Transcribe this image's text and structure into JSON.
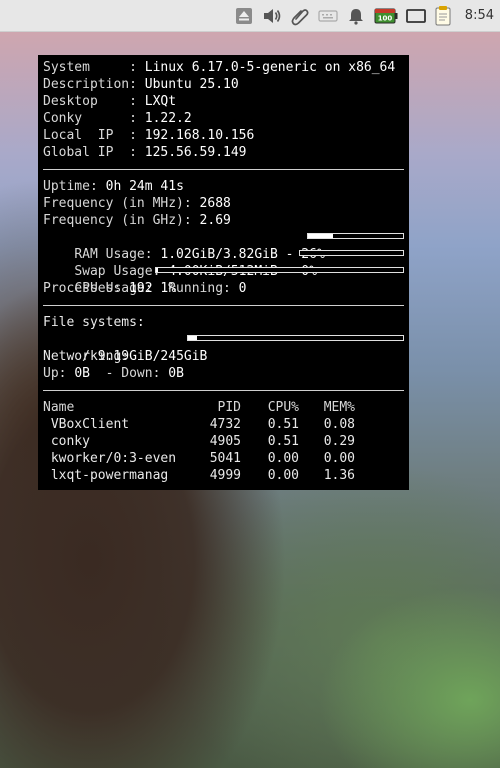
{
  "panel": {
    "clock": "8:54",
    "battery_badge": "100",
    "icons": [
      "eject-icon",
      "volume-icon",
      "paperclip-icon",
      "keyboard-icon",
      "notification-bell-icon",
      "battery-icon",
      "display-icon",
      "clipboard-note-icon"
    ]
  },
  "conky": {
    "info": [
      {
        "label": "System     : ",
        "value": "Linux 6.17.0-5-generic on x86_64"
      },
      {
        "label": "Description: ",
        "value": "Ubuntu 25.10"
      },
      {
        "label": "Desktop    : ",
        "value": "LXQt"
      },
      {
        "label": "Conky      : ",
        "value": "1.22.2"
      },
      {
        "label": "Local  IP  : ",
        "value": "192.168.10.156"
      },
      {
        "label": "Global IP  : ",
        "value": "125.56.59.149"
      }
    ],
    "uptime": {
      "label": "Uptime: ",
      "value": "0h 24m 41s"
    },
    "freq_mhz": {
      "label": "Frequency (in MHz): ",
      "value": "2688"
    },
    "freq_ghz": {
      "label": "Frequency (in GHz): ",
      "value": "2.69"
    },
    "ram": {
      "label": "RAM Usage: ",
      "value": "1.02GiB/3.82GiB - 26%",
      "percent": 26
    },
    "swap": {
      "label": "Swap Usage: ",
      "value": "4.00KiB/512MiB - 0%",
      "percent": 0
    },
    "cpu": {
      "label": "CPU Usage: ",
      "value": "1%",
      "percent": 1
    },
    "processes": {
      "label": "Processes: ",
      "value": "192",
      "running_label": "  Running: ",
      "running_value": "0"
    },
    "fs_header": "File systems:",
    "fs_root": {
      "label": " / ",
      "value": "9.19GiB/245GiB",
      "percent": 4
    },
    "net_header": "Networking:",
    "net": {
      "up_label": "Up: ",
      "up_value": "0B",
      "down_label": "  - Down: ",
      "down_value": "0B"
    },
    "proc_headers": {
      "name": "Name",
      "pid": "PID",
      "cpu": "CPU%",
      "mem": "MEM%"
    },
    "procs": [
      {
        "name": " VBoxClient",
        "pid": "4732",
        "cpu": "0.51",
        "mem": "0.08"
      },
      {
        "name": " conky",
        "pid": "4905",
        "cpu": "0.51",
        "mem": "0.29"
      },
      {
        "name": " kworker/0:3-even",
        "pid": "5041",
        "cpu": "0.00",
        "mem": "0.00"
      },
      {
        "name": " lxqt-powermanag",
        "pid": "4999",
        "cpu": "0.00",
        "mem": "1.36"
      }
    ]
  }
}
